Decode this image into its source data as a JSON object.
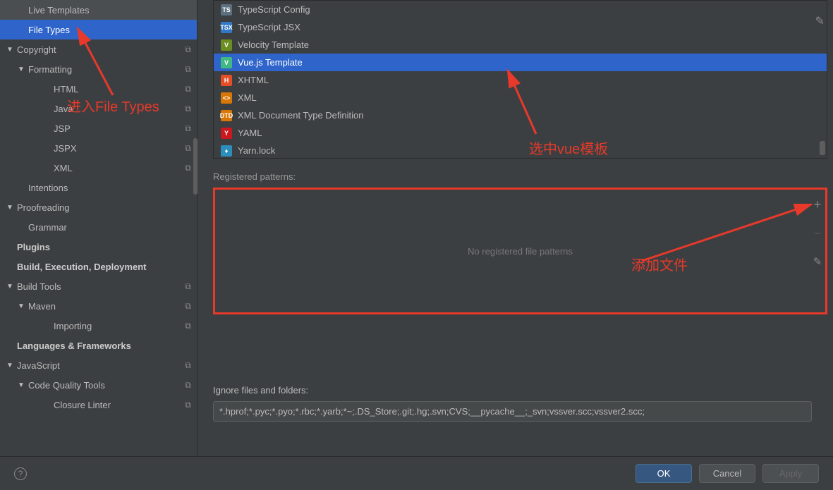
{
  "sidebar": {
    "items": [
      {
        "label": "Live Templates",
        "indent": 1,
        "chevron": "",
        "copy": false,
        "bold": false
      },
      {
        "label": "File Types",
        "indent": 1,
        "chevron": "",
        "copy": false,
        "bold": false,
        "selected": true
      },
      {
        "label": "Copyright",
        "indent": 0,
        "chevron": "▼",
        "copy": true,
        "bold": false
      },
      {
        "label": "Formatting",
        "indent": 1,
        "chevron": "▼",
        "copy": true,
        "bold": false
      },
      {
        "label": "HTML",
        "indent": 3,
        "chevron": "",
        "copy": true,
        "bold": false
      },
      {
        "label": "Java",
        "indent": 3,
        "chevron": "",
        "copy": true,
        "bold": false
      },
      {
        "label": "JSP",
        "indent": 3,
        "chevron": "",
        "copy": true,
        "bold": false
      },
      {
        "label": "JSPX",
        "indent": 3,
        "chevron": "",
        "copy": true,
        "bold": false
      },
      {
        "label": "XML",
        "indent": 3,
        "chevron": "",
        "copy": true,
        "bold": false
      },
      {
        "label": "Intentions",
        "indent": 1,
        "chevron": "",
        "copy": false,
        "bold": false
      },
      {
        "label": "Proofreading",
        "indent": 0,
        "chevron": "▼",
        "copy": false,
        "bold": false
      },
      {
        "label": "Grammar",
        "indent": 1,
        "chevron": "",
        "copy": false,
        "bold": false
      },
      {
        "label": "Plugins",
        "indent": 0,
        "chevron": "",
        "copy": false,
        "bold": true
      },
      {
        "label": "Build, Execution, Deployment",
        "indent": 0,
        "chevron": "",
        "copy": false,
        "bold": true
      },
      {
        "label": "Build Tools",
        "indent": 0,
        "chevron": "▼",
        "copy": true,
        "bold": false
      },
      {
        "label": "Maven",
        "indent": 1,
        "chevron": "▼",
        "copy": true,
        "bold": false
      },
      {
        "label": "Importing",
        "indent": 3,
        "chevron": "",
        "copy": true,
        "bold": false
      },
      {
        "label": "Languages & Frameworks",
        "indent": 0,
        "chevron": "",
        "copy": false,
        "bold": true
      },
      {
        "label": "JavaScript",
        "indent": 0,
        "chevron": "▼",
        "copy": true,
        "bold": false
      },
      {
        "label": "Code Quality Tools",
        "indent": 1,
        "chevron": "▼",
        "copy": true,
        "bold": false
      },
      {
        "label": "Closure Linter",
        "indent": 3,
        "chevron": "",
        "copy": true,
        "bold": false
      }
    ]
  },
  "fileTypes": {
    "items": [
      {
        "label": "TypeScript Config",
        "iconBg": "#5c7080",
        "iconColor": "#fff",
        "iconText": "TS"
      },
      {
        "label": "TypeScript JSX",
        "iconBg": "#3178c6",
        "iconColor": "#fff",
        "iconText": "TSX"
      },
      {
        "label": "Velocity Template",
        "iconBg": "#6b8e23",
        "iconColor": "#fff",
        "iconText": "V"
      },
      {
        "label": "Vue.js Template",
        "iconBg": "#42b883",
        "iconColor": "#fff",
        "iconText": "V",
        "selected": true
      },
      {
        "label": "XHTML",
        "iconBg": "#e44d26",
        "iconColor": "#fff",
        "iconText": "H"
      },
      {
        "label": "XML",
        "iconBg": "#d97706",
        "iconColor": "#fff",
        "iconText": "<>"
      },
      {
        "label": "XML Document Type Definition",
        "iconBg": "#d97706",
        "iconColor": "#fff",
        "iconText": "DTD"
      },
      {
        "label": "YAML",
        "iconBg": "#cb171e",
        "iconColor": "#fff",
        "iconText": "Y"
      },
      {
        "label": "Yarn.lock",
        "iconBg": "#2c8ebb",
        "iconColor": "#fff",
        "iconText": "♦"
      }
    ]
  },
  "patterns": {
    "label": "Registered patterns:",
    "empty": "No registered file patterns"
  },
  "ignore": {
    "label": "Ignore files and folders:",
    "value": "*.hprof;*.pyc;*.pyo;*.rbc;*.yarb;*~;.DS_Store;.git;.hg;.svn;CVS;__pycache__;_svn;vssver.scc;vssver2.scc;"
  },
  "buttons": {
    "ok": "OK",
    "cancel": "Cancel",
    "apply": "Apply"
  },
  "annotations": {
    "a1": "进入File Types",
    "a2": "选中vue模板",
    "a3": "添加文件"
  }
}
